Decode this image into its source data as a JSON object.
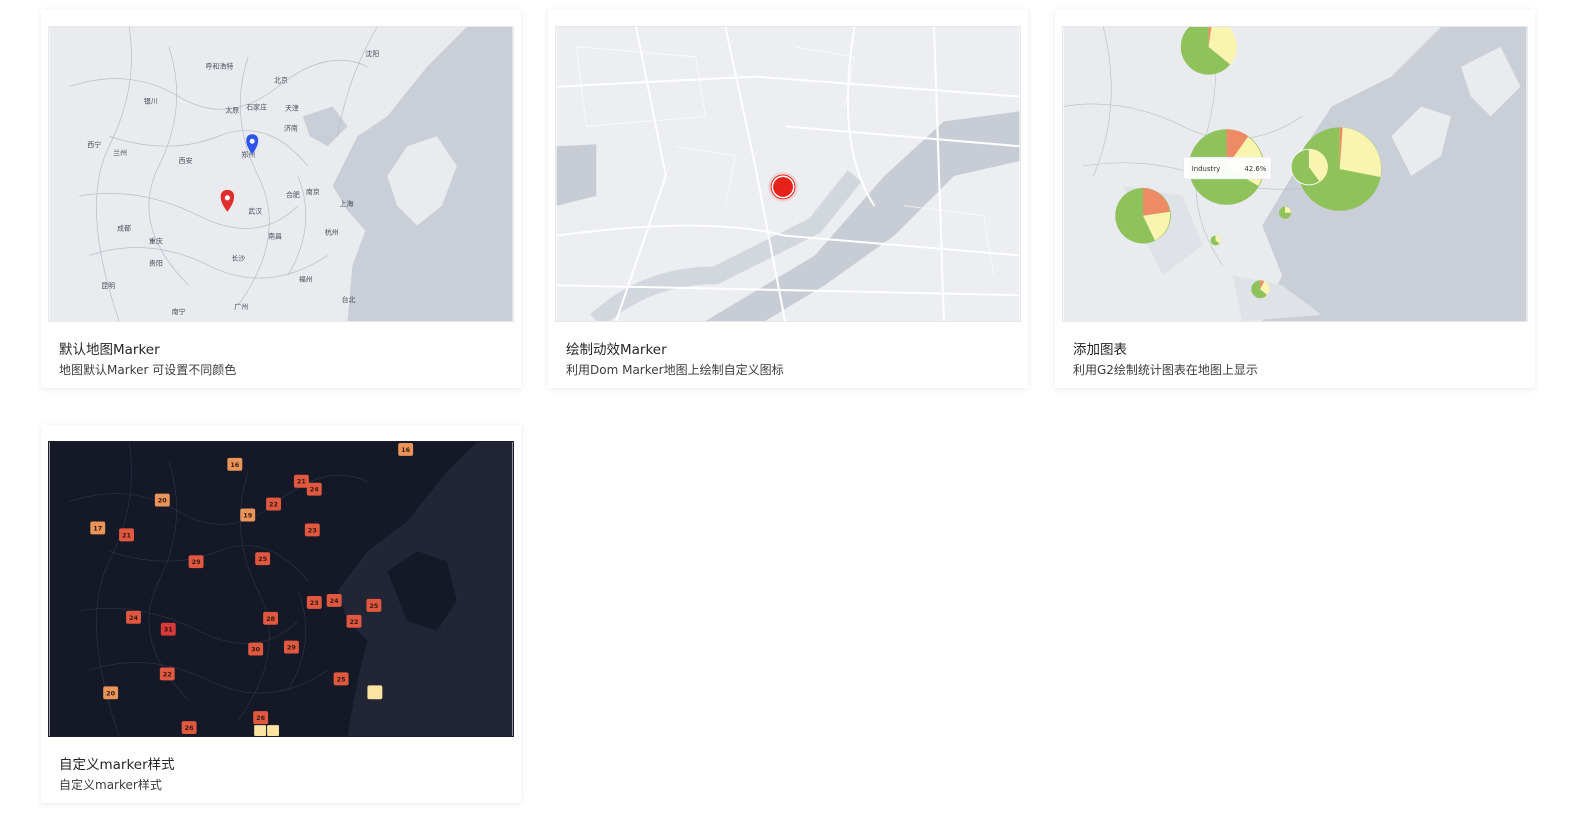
{
  "cards": [
    {
      "title": "默认地图Marker",
      "description": "地图默认Marker 可设置不同颜色",
      "cities": [
        "呼和浩特",
        "沈阳",
        "北京",
        "银川",
        "太原",
        "石家庄",
        "天津",
        "济南",
        "西宁",
        "兰州",
        "郑州",
        "西安",
        "合肥",
        "南京",
        "上海",
        "武汉",
        "成都",
        "重庆",
        "杭州",
        "南昌",
        "贵阳",
        "长沙",
        "昆明",
        "福州",
        "南宁",
        "广州",
        "台北"
      ],
      "marker_colors": [
        "#2f54eb",
        "#e02d2d"
      ]
    },
    {
      "title": "绘制动效Marker",
      "description": "利用Dom Marker地图上绘制自定义图标",
      "marker_color": "#e8221b"
    },
    {
      "title": "添加图表",
      "description": "利用G2绘制统计图表在地图上显示",
      "tooltip": {
        "label": "Industry",
        "value": "42.6%"
      },
      "pie_colors": [
        "#8fc25a",
        "#f9f5b0",
        "#ee8b67"
      ]
    },
    {
      "title": "自定义marker样式",
      "description": "自定义marker样式",
      "marker_values": [
        "16",
        "16",
        "20",
        "21",
        "24",
        "22",
        "19",
        "17",
        "21",
        "23",
        "29",
        "25",
        "24",
        "23",
        "24",
        "25",
        "28",
        "31",
        "22",
        "30",
        "29",
        "22",
        "25",
        "20",
        "26",
        "26"
      ]
    }
  ]
}
